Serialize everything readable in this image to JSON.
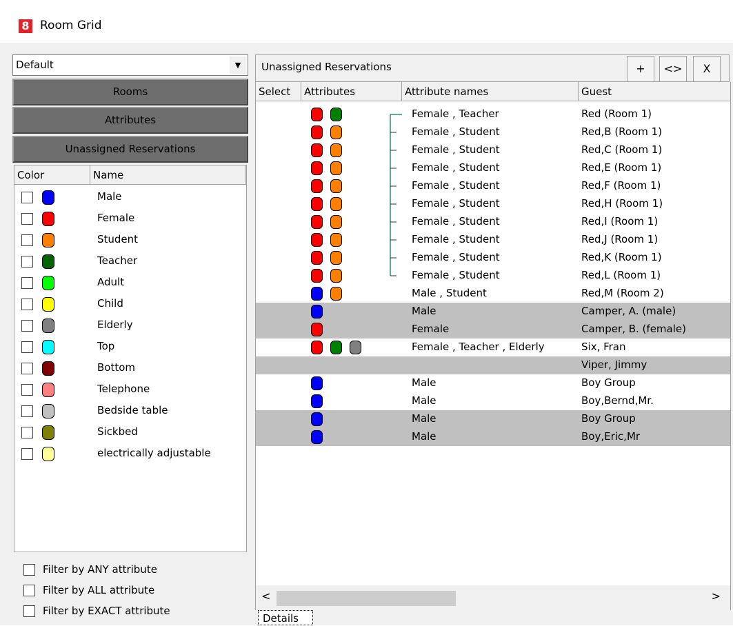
{
  "window": {
    "icon_text": "8",
    "title": "Room Grid"
  },
  "left": {
    "profile_value": "Default",
    "nav": {
      "rooms": "Rooms",
      "attributes": "Attributes",
      "unassigned": "Unassigned Reservations"
    },
    "list_headers": {
      "color": "Color",
      "name": "Name"
    },
    "attributes": [
      {
        "name": "Male",
        "color": "#0000ff"
      },
      {
        "name": "Female",
        "color": "#ff0000"
      },
      {
        "name": "Student",
        "color": "#ff8000"
      },
      {
        "name": "Teacher",
        "color": "#006400"
      },
      {
        "name": "Adult",
        "color": "#00ff00"
      },
      {
        "name": "Child",
        "color": "#ffff00"
      },
      {
        "name": "Elderly",
        "color": "#808080"
      },
      {
        "name": "Top",
        "color": "#00ffff"
      },
      {
        "name": "Bottom",
        "color": "#800000"
      },
      {
        "name": "Telephone",
        "color": "#ff8080"
      },
      {
        "name": "Bedside table",
        "color": "#c0c0c0"
      },
      {
        "name": "Sickbed",
        "color": "#808000"
      },
      {
        "name": "electrically adjustable",
        "color": "#ffff99"
      }
    ],
    "filters": {
      "any": "Filter by ANY attribute",
      "all": "Filter by ALL attribute",
      "exact": "Filter by EXACT attribute"
    }
  },
  "right": {
    "title": "Unassigned Reservations",
    "buttons": {
      "add": "+",
      "swap": "<>",
      "close": "X"
    },
    "columns": {
      "select": "Select",
      "attributes": "Attributes",
      "attribute_names": "Attribute names",
      "guest": "Guest"
    },
    "rows": [
      {
        "colors": [
          "#ff0000",
          "#008000"
        ],
        "names": "Female , Teacher",
        "guest": "Red (Room 1)",
        "alt": false
      },
      {
        "colors": [
          "#ff0000",
          "#ff8000"
        ],
        "names": "Female , Student",
        "guest": "Red,B (Room 1)",
        "alt": false
      },
      {
        "colors": [
          "#ff0000",
          "#ff8000"
        ],
        "names": "Female , Student",
        "guest": "Red,C (Room 1)",
        "alt": false
      },
      {
        "colors": [
          "#ff0000",
          "#ff8000"
        ],
        "names": "Female , Student",
        "guest": "Red,E (Room 1)",
        "alt": false
      },
      {
        "colors": [
          "#ff0000",
          "#ff8000"
        ],
        "names": "Female , Student",
        "guest": "Red,F (Room 1)",
        "alt": false
      },
      {
        "colors": [
          "#ff0000",
          "#ff8000"
        ],
        "names": "Female , Student",
        "guest": "Red,H (Room 1)",
        "alt": false
      },
      {
        "colors": [
          "#ff0000",
          "#ff8000"
        ],
        "names": "Female , Student",
        "guest": "Red,I (Room 1)",
        "alt": false
      },
      {
        "colors": [
          "#ff0000",
          "#ff8000"
        ],
        "names": "Female , Student",
        "guest": "Red,J (Room 1)",
        "alt": false
      },
      {
        "colors": [
          "#ff0000",
          "#ff8000"
        ],
        "names": "Female , Student",
        "guest": "Red,K (Room 1)",
        "alt": false
      },
      {
        "colors": [
          "#ff0000",
          "#ff8000"
        ],
        "names": "Female , Student",
        "guest": "Red,L (Room 1)",
        "alt": false
      },
      {
        "colors": [
          "#0000ff",
          "#ff8000"
        ],
        "names": "Male , Student",
        "guest": "Red,M (Room 2)",
        "alt": false
      },
      {
        "colors": [
          "#0000ff"
        ],
        "names": "Male",
        "guest": "Camper, A. (male)",
        "alt": true
      },
      {
        "colors": [
          "#ff0000"
        ],
        "names": "Female",
        "guest": "Camper, B. (female)",
        "alt": true
      },
      {
        "colors": [
          "#ff0000",
          "#008000",
          "#808080"
        ],
        "names": "Female , Teacher , Elderly",
        "guest": "Six, Fran",
        "alt": false
      },
      {
        "colors": [],
        "names": "",
        "guest": "Viper, Jimmy",
        "alt": true
      },
      {
        "colors": [
          "#0000ff"
        ],
        "names": "Male",
        "guest": "Boy Group",
        "alt": false
      },
      {
        "colors": [
          "#0000ff"
        ],
        "names": "Male",
        "guest": "Boy,Bernd,Mr.",
        "alt": false
      },
      {
        "colors": [
          "#0000ff"
        ],
        "names": "Male",
        "guest": "Boy Group",
        "alt": true
      },
      {
        "colors": [
          "#0000ff"
        ],
        "names": "Male",
        "guest": "Boy,Eric,Mr",
        "alt": true
      }
    ],
    "scroll": {
      "left": "<",
      "right": ">"
    },
    "details_tab": "Details"
  }
}
